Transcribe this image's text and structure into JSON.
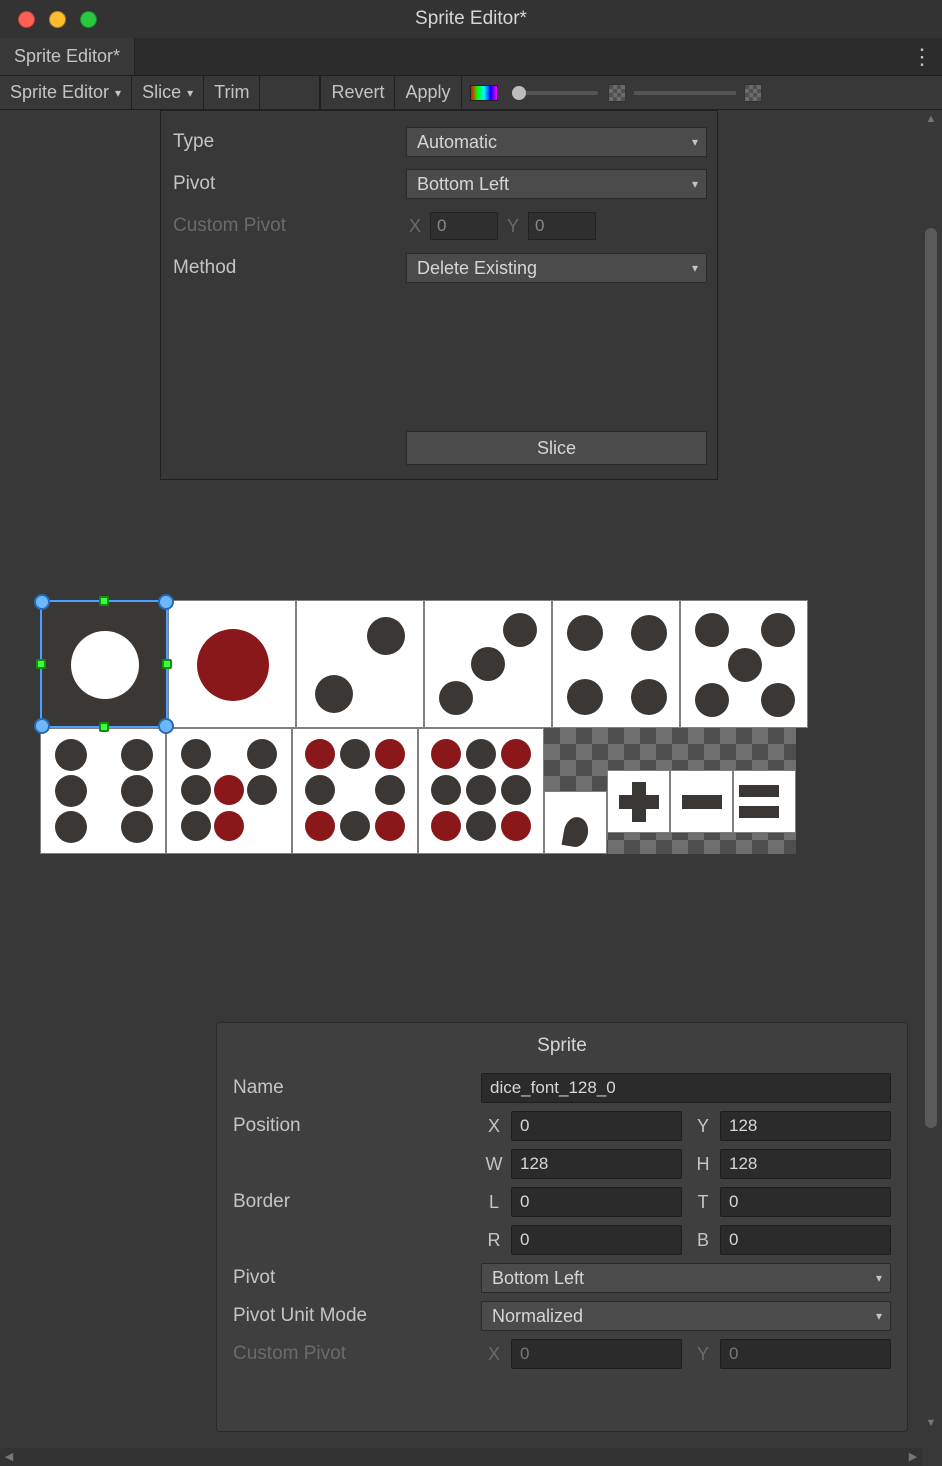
{
  "window": {
    "title": "Sprite Editor*"
  },
  "tab": {
    "name": "Sprite Editor*"
  },
  "toolbar": {
    "sprite_editor": "Sprite Editor",
    "slice": "Slice",
    "trim": "Trim",
    "revert": "Revert",
    "apply": "Apply"
  },
  "slice_panel": {
    "type_label": "Type",
    "type_value": "Automatic",
    "pivot_label": "Pivot",
    "pivot_value": "Bottom Left",
    "custom_pivot_label": "Custom Pivot",
    "custom_pivot_x_label": "X",
    "custom_pivot_x": "0",
    "custom_pivot_y_label": "Y",
    "custom_pivot_y": "0",
    "method_label": "Method",
    "method_value": "Delete Existing",
    "slice_button": "Slice"
  },
  "inspector": {
    "title": "Sprite",
    "name_label": "Name",
    "name_value": "dice_font_128_0",
    "position_label": "Position",
    "pos_x_label": "X",
    "pos_x": "0",
    "pos_y_label": "Y",
    "pos_y": "128",
    "pos_w_label": "W",
    "pos_w": "128",
    "pos_h_label": "H",
    "pos_h": "128",
    "border_label": "Border",
    "bor_l_label": "L",
    "bor_l": "0",
    "bor_t_label": "T",
    "bor_t": "0",
    "bor_r_label": "R",
    "bor_r": "0",
    "bor_b_label": "B",
    "bor_b": "0",
    "pivot_label": "Pivot",
    "pivot_value": "Bottom Left",
    "pivot_unit_label": "Pivot Unit Mode",
    "pivot_unit_value": "Normalized",
    "custom_pivot_label": "Custom Pivot",
    "custom_x_label": "X",
    "custom_x": "0",
    "custom_y_label": "Y",
    "custom_y": "0"
  }
}
